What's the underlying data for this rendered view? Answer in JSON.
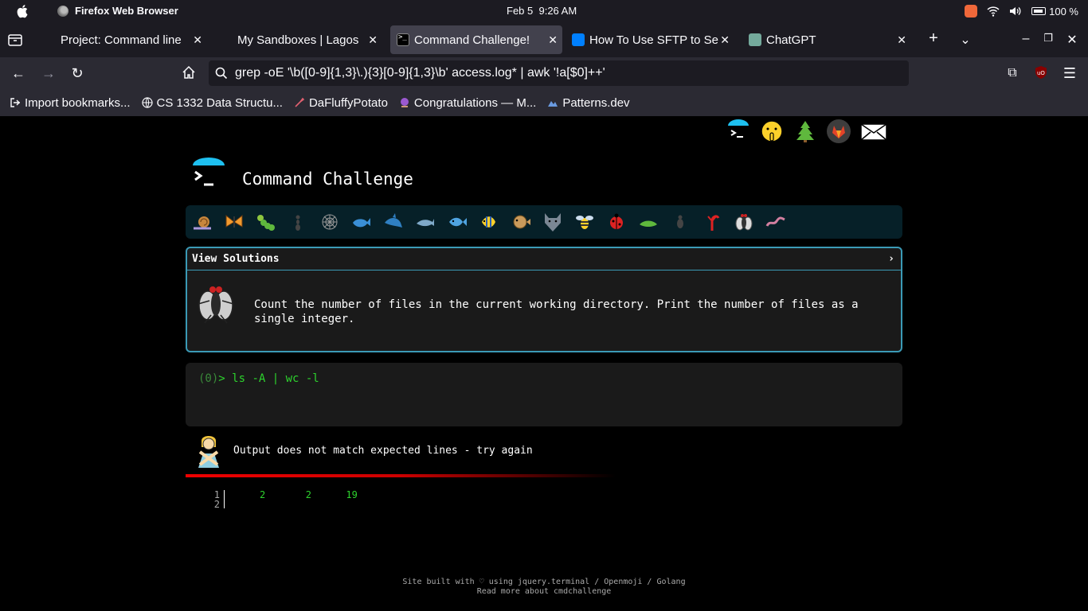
{
  "menubar": {
    "app_name": "Firefox Web Browser",
    "date": "Feb 5",
    "time": "9:26 AM",
    "battery": "100 %"
  },
  "tabs": [
    {
      "label": "Project: Command line",
      "active": false
    },
    {
      "label": "My Sandboxes | Lagos",
      "active": false
    },
    {
      "label": "Command Challenge!",
      "active": true
    },
    {
      "label": "How To Use SFTP to Se",
      "active": false
    },
    {
      "label": "ChatGPT",
      "active": false
    }
  ],
  "navbar": {
    "url": "grep -oE '\\b([0-9]{1,3}\\.){3}[0-9]{1,3}\\b' access.log* | awk '!a[$0]++'"
  },
  "bookmarks": [
    {
      "label": "Import bookmarks..."
    },
    {
      "label": "CS 1332 Data Structu..."
    },
    {
      "label": "DaFluffyPotato"
    },
    {
      "label": "Congratulations — M..."
    },
    {
      "label": "Patterns.dev"
    }
  ],
  "page": {
    "title": "Command Challenge",
    "panel_header": "View Solutions",
    "panel_chevron": "›",
    "task": "Count the number of files in the current working directory. Print the number of files as a single integer.",
    "prompt_prefix": "(0)> ",
    "prompt_prefix_num": "(0)",
    "prompt_command": "ls -A | wc -l",
    "result_message": "Output does not match expected lines - try again",
    "output_lines": [
      "1",
      "2"
    ],
    "output_values": "2       2      19",
    "footer_line1": "Site built with ♡ using jquery.terminal / Openmoji / Golang",
    "footer_line2": "Read more about cmdchallenge"
  },
  "challenge_icons": [
    "snail",
    "butterfly",
    "caterpillar",
    "ant",
    "spider-web",
    "whale",
    "shark",
    "dolphin",
    "fish",
    "tropical-fish",
    "blowfish",
    "wolf",
    "bee",
    "ladybug",
    "leaf-bug",
    "beetle",
    "scorpion",
    "fly",
    "worm"
  ],
  "colors": {
    "accent": "#3b9ab6",
    "prompt_green": "#2dd32d",
    "error_red": "#e00000"
  }
}
